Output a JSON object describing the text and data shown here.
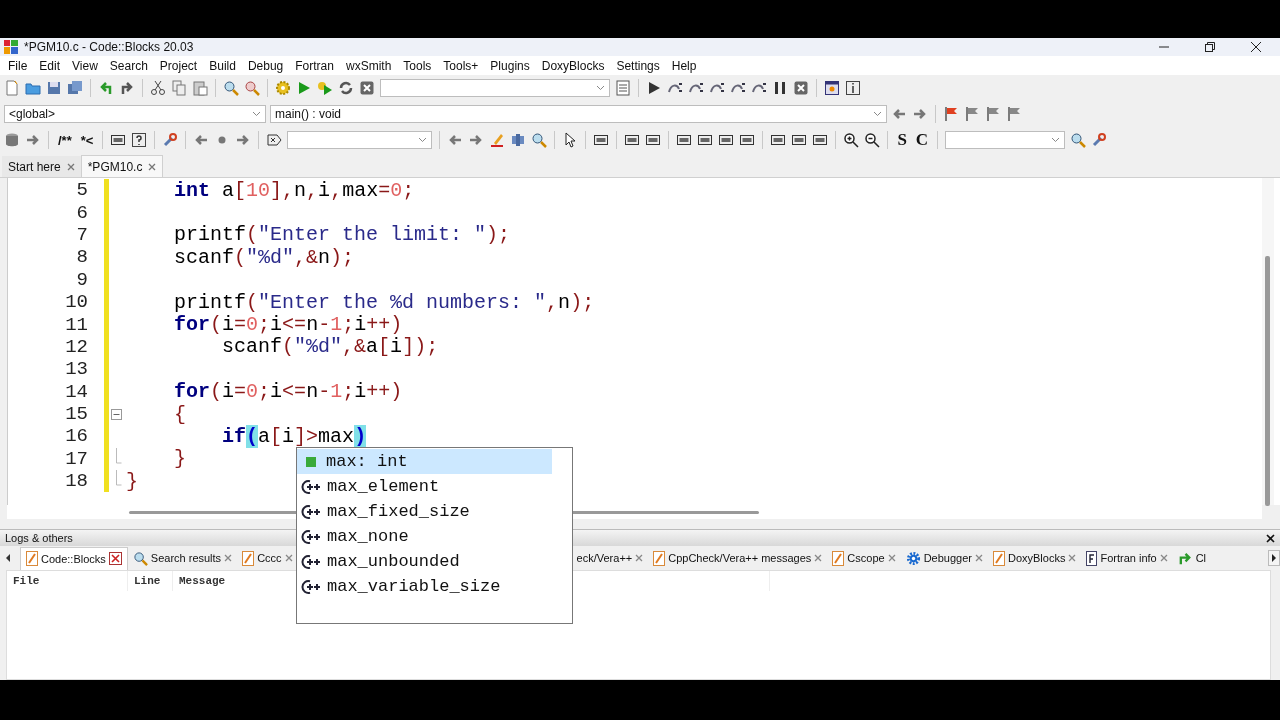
{
  "window": {
    "title": "*PGM10.c - Code::Blocks 20.03"
  },
  "menu": [
    "File",
    "Edit",
    "View",
    "Search",
    "Project",
    "Build",
    "Debug",
    "Fortran",
    "wxSmith",
    "Tools",
    "Tools+",
    "Plugins",
    "DoxyBlocks",
    "Settings",
    "Help"
  ],
  "toolbar": {
    "scope": "<global>",
    "function": "main() : void",
    "comment_buttons": [
      "/**",
      "*<"
    ],
    "format_buttons": [
      "S",
      "C"
    ]
  },
  "editor_tabs": [
    {
      "label": "Start here",
      "selected": false
    },
    {
      "label": "*PGM10.c",
      "selected": true
    }
  ],
  "editor": {
    "lines": [
      {
        "number": "5",
        "changed": true,
        "tokens": [
          {
            "kind": "keyword",
            "text": "    int"
          },
          {
            "kind": "plain",
            "text": " a"
          },
          {
            "kind": "op",
            "text": "["
          },
          {
            "kind": "number",
            "text": "10"
          },
          {
            "kind": "op",
            "text": "],"
          },
          {
            "kind": "plain",
            "text": "n"
          },
          {
            "kind": "op",
            "text": ","
          },
          {
            "kind": "plain",
            "text": "i"
          },
          {
            "kind": "op",
            "text": ","
          },
          {
            "kind": "plain",
            "text": "max"
          },
          {
            "kind": "op",
            "text": "="
          },
          {
            "kind": "number",
            "text": "0"
          },
          {
            "kind": "op",
            "text": ";"
          }
        ]
      },
      {
        "number": "6",
        "changed": true
      },
      {
        "number": "7",
        "changed": true,
        "tokens": [
          {
            "kind": "plain",
            "text": "    printf"
          },
          {
            "kind": "op",
            "text": "("
          },
          {
            "kind": "string",
            "text": "\"Enter the limit: \""
          },
          {
            "kind": "op",
            "text": ");"
          }
        ]
      },
      {
        "number": "8",
        "changed": true,
        "tokens": [
          {
            "kind": "plain",
            "text": "    scanf"
          },
          {
            "kind": "op",
            "text": "("
          },
          {
            "kind": "string",
            "text": "\"%d\""
          },
          {
            "kind": "op",
            "text": ",&"
          },
          {
            "kind": "plain",
            "text": "n"
          },
          {
            "kind": "op",
            "text": ");"
          }
        ]
      },
      {
        "number": "9",
        "changed": true
      },
      {
        "number": "10",
        "changed": true,
        "tokens": [
          {
            "kind": "plain",
            "text": "    printf"
          },
          {
            "kind": "op",
            "text": "("
          },
          {
            "kind": "string",
            "text": "\"Enter the %d numbers: \""
          },
          {
            "kind": "op",
            "text": ","
          },
          {
            "kind": "plain",
            "text": "n"
          },
          {
            "kind": "op",
            "text": ");"
          }
        ]
      },
      {
        "number": "11",
        "changed": true,
        "tokens": [
          {
            "kind": "keyword",
            "text": "    for"
          },
          {
            "kind": "op",
            "text": "("
          },
          {
            "kind": "plain",
            "text": "i"
          },
          {
            "kind": "op",
            "text": "="
          },
          {
            "kind": "number",
            "text": "0"
          },
          {
            "kind": "op",
            "text": ";"
          },
          {
            "kind": "plain",
            "text": "i"
          },
          {
            "kind": "op",
            "text": "<="
          },
          {
            "kind": "plain",
            "text": "n"
          },
          {
            "kind": "op",
            "text": "-"
          },
          {
            "kind": "number",
            "text": "1"
          },
          {
            "kind": "op",
            "text": ";"
          },
          {
            "kind": "plain",
            "text": "i"
          },
          {
            "kind": "op",
            "text": "++)"
          }
        ]
      },
      {
        "number": "12",
        "changed": true,
        "tokens": [
          {
            "kind": "plain",
            "text": "        scanf"
          },
          {
            "kind": "op",
            "text": "("
          },
          {
            "kind": "string",
            "text": "\"%d\""
          },
          {
            "kind": "op",
            "text": ",&"
          },
          {
            "kind": "plain",
            "text": "a"
          },
          {
            "kind": "op",
            "text": "["
          },
          {
            "kind": "plain",
            "text": "i"
          },
          {
            "kind": "op",
            "text": "]);"
          }
        ]
      },
      {
        "number": "13",
        "changed": true
      },
      {
        "number": "14",
        "changed": true,
        "tokens": [
          {
            "kind": "keyword",
            "text": "    for"
          },
          {
            "kind": "op",
            "text": "("
          },
          {
            "kind": "plain",
            "text": "i"
          },
          {
            "kind": "op",
            "text": "="
          },
          {
            "kind": "number",
            "text": "0"
          },
          {
            "kind": "op",
            "text": ";"
          },
          {
            "kind": "plain",
            "text": "i"
          },
          {
            "kind": "op",
            "text": "<="
          },
          {
            "kind": "plain",
            "text": "n"
          },
          {
            "kind": "op",
            "text": "-"
          },
          {
            "kind": "number",
            "text": "1"
          },
          {
            "kind": "op",
            "text": ";"
          },
          {
            "kind": "plain",
            "text": "i"
          },
          {
            "kind": "op",
            "text": "++)"
          }
        ]
      },
      {
        "number": "15",
        "changed": true,
        "fold_open": true,
        "tokens": [
          {
            "kind": "op",
            "text": "    {"
          }
        ]
      },
      {
        "number": "16",
        "changed": true,
        "tokens": [
          {
            "kind": "keyword",
            "text": "        if"
          },
          {
            "kind": "match",
            "text": "("
          },
          {
            "kind": "plain",
            "text": "a"
          },
          {
            "kind": "op",
            "text": "["
          },
          {
            "kind": "plain",
            "text": "i"
          },
          {
            "kind": "op",
            "text": "]>"
          },
          {
            "kind": "plain",
            "text": "max"
          },
          {
            "kind": "match",
            "text": ")"
          }
        ]
      },
      {
        "number": "17",
        "changed": true,
        "block_end": true,
        "tokens": [
          {
            "kind": "op",
            "text": "    }"
          }
        ]
      },
      {
        "number": "18",
        "changed": true,
        "block_end": true,
        "tokens": [
          {
            "kind": "op",
            "text": "}"
          }
        ]
      }
    ]
  },
  "autocomplete": [
    {
      "label": "max: int",
      "kind": "variable",
      "selected": true
    },
    {
      "label": "max_element",
      "kind": "class",
      "selected": false
    },
    {
      "label": "max_fixed_size",
      "kind": "class",
      "selected": false
    },
    {
      "label": "max_none",
      "kind": "class",
      "selected": false
    },
    {
      "label": "max_unbounded",
      "kind": "class",
      "selected": false
    },
    {
      "label": "max_variable_size",
      "kind": "class",
      "selected": false
    }
  ],
  "logs": {
    "title": "Logs & others",
    "tabs": [
      {
        "label": "Code::Blocks",
        "selected": true
      },
      {
        "label": "Search results",
        "selected": false
      },
      {
        "label": "Cccc",
        "selected": false
      },
      {
        "label": "eck/Vera++",
        "selected": false
      },
      {
        "label": "CppCheck/Vera++ messages",
        "selected": false
      },
      {
        "label": "Cscope",
        "selected": false
      },
      {
        "label": "Debugger",
        "selected": false
      },
      {
        "label": "DoxyBlocks",
        "selected": false
      },
      {
        "label": "Fortran info",
        "selected": false
      },
      {
        "label": "Cl",
        "selected": false
      }
    ],
    "columns": [
      "File",
      "Line",
      "Message"
    ]
  }
}
